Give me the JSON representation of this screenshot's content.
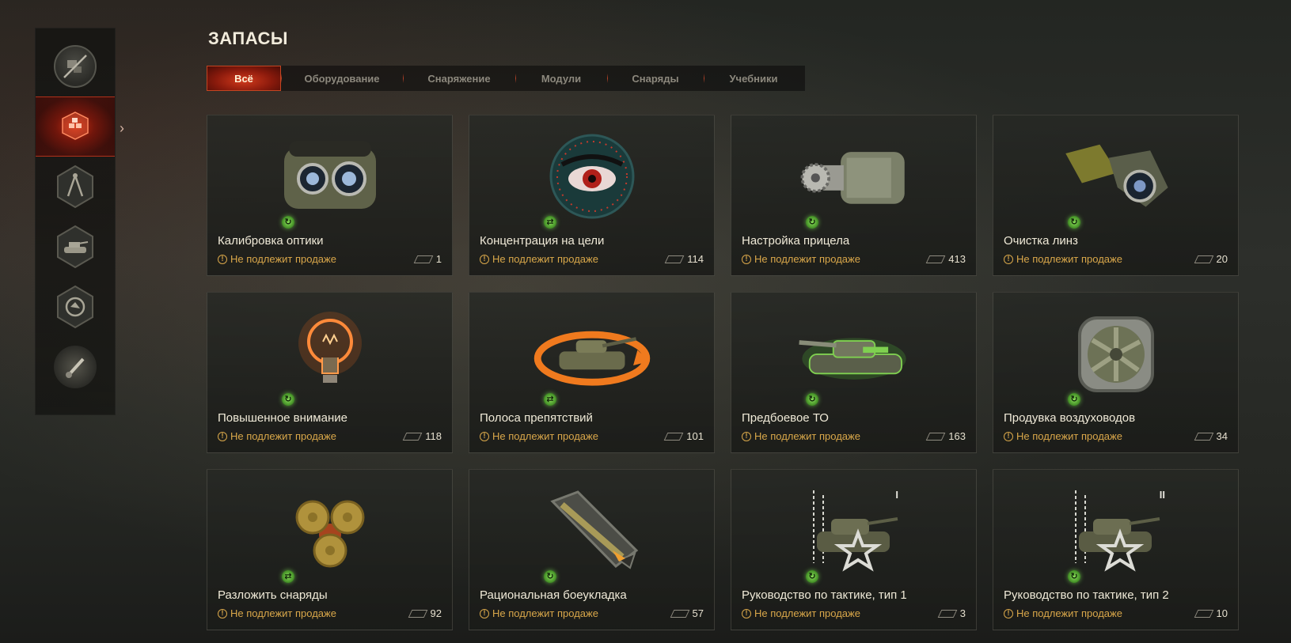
{
  "page": {
    "title": "ЗАПАСЫ",
    "accent_color": "#c8321a",
    "status_color": "#d9a74a"
  },
  "sidebar": {
    "items": [
      {
        "icon": "crossed-out-items-icon",
        "active": false
      },
      {
        "icon": "stock-boxes-icon",
        "active": true
      },
      {
        "icon": "compass-blueprint-icon",
        "active": false
      },
      {
        "icon": "tank-icon",
        "active": false
      },
      {
        "icon": "crew-skills-icon",
        "active": false
      },
      {
        "icon": "paintbrush-icon",
        "active": false
      }
    ]
  },
  "tabs": [
    {
      "label": "Всё",
      "active": true
    },
    {
      "label": "Оборудование",
      "active": false
    },
    {
      "label": "Снаряжение",
      "active": false
    },
    {
      "label": "Модули",
      "active": false
    },
    {
      "label": "Снаряды",
      "active": false
    },
    {
      "label": "Учебники",
      "active": false
    }
  ],
  "items": [
    {
      "name": "Калибровка оптики",
      "status": "Не подлежит продаже",
      "count": "1",
      "icon": "binocular-optics-icon",
      "kind": "refresh"
    },
    {
      "name": "Концентрация на цели",
      "status": "Не подлежит продаже",
      "count": "114",
      "icon": "red-eye-icon",
      "kind": "swap"
    },
    {
      "name": "Настройка прицела",
      "status": "Не подлежит продаже",
      "count": "413",
      "icon": "gear-motor-icon",
      "kind": "refresh"
    },
    {
      "name": "Очистка линз",
      "status": "Не подлежит продаже",
      "count": "20",
      "icon": "periscope-lens-icon",
      "kind": "refresh"
    },
    {
      "name": "Повышенное внимание",
      "status": "Не подлежит продаже",
      "count": "118",
      "icon": "light-bulb-icon",
      "kind": "refresh"
    },
    {
      "name": "Полоса препятствий",
      "status": "Не подлежит продаже",
      "count": "101",
      "icon": "tank-circuit-icon",
      "kind": "swap"
    },
    {
      "name": "Предбоевое ТО",
      "status": "Не подлежит продаже",
      "count": "163",
      "icon": "tank-maintenance-icon",
      "kind": "refresh"
    },
    {
      "name": "Продувка воздуховодов",
      "status": "Не подлежит продаже",
      "count": "34",
      "icon": "ventilation-fan-icon",
      "kind": "refresh"
    },
    {
      "name": "Разложить снаряды",
      "status": "Не подлежит продаже",
      "count": "92",
      "icon": "shell-bases-icon",
      "kind": "swap"
    },
    {
      "name": "Рациональная боеукладка",
      "status": "Не подлежит продаже",
      "count": "57",
      "icon": "shell-rack-icon",
      "kind": "refresh"
    },
    {
      "name": "Руководство по тактике, тип 1",
      "status": "Не подлежит продаже",
      "count": "3",
      "icon": "tactics-manual-icon",
      "kind": "refresh",
      "rank": "I"
    },
    {
      "name": "Руководство по тактике, тип 2",
      "status": "Не подлежит продаже",
      "count": "10",
      "icon": "tactics-manual-icon",
      "kind": "refresh",
      "rank": "II"
    }
  ]
}
